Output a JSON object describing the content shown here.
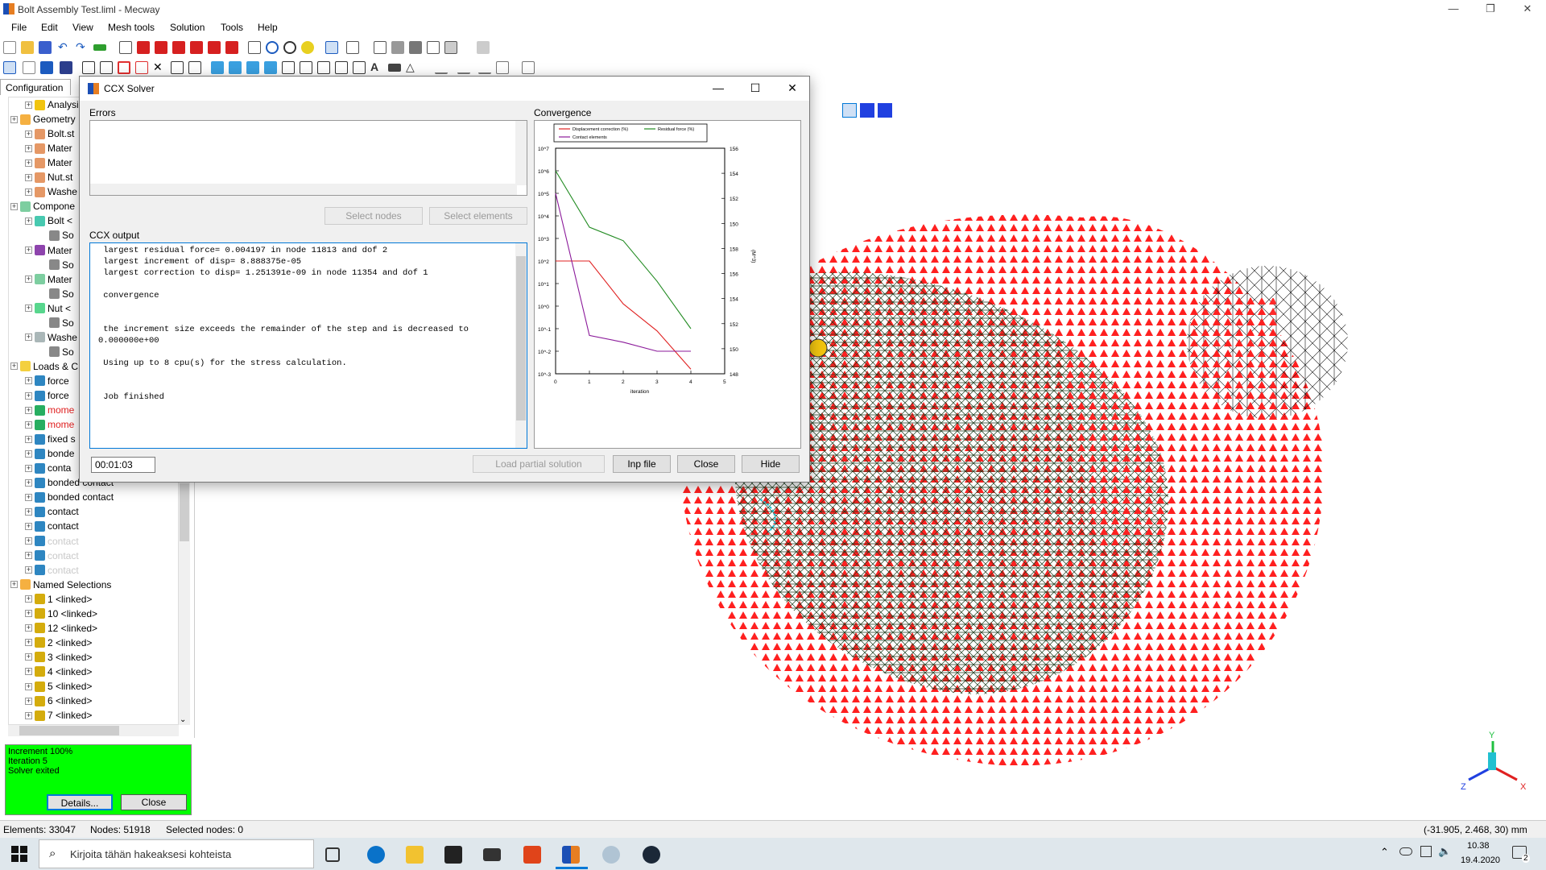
{
  "window": {
    "title": "Bolt Assembly Test.liml - Mecway",
    "minimize": "—",
    "restore": "❐",
    "close": "✕"
  },
  "menu": [
    "File",
    "Edit",
    "View",
    "Mesh tools",
    "Solution",
    "Tools",
    "Help"
  ],
  "left_panel": {
    "tab": "Configuration",
    "tree": [
      {
        "label": "Analysis <",
        "depth": 1,
        "color": "#f1c40f"
      },
      {
        "label": "Geometry",
        "depth": 0,
        "color": "#f5b041"
      },
      {
        "label": "Bolt.st",
        "depth": 1,
        "color": "#e59866"
      },
      {
        "label": "Mater",
        "depth": 1,
        "color": "#e59866"
      },
      {
        "label": "Mater",
        "depth": 1,
        "color": "#e59866"
      },
      {
        "label": "Nut.st",
        "depth": 1,
        "color": "#e59866"
      },
      {
        "label": "Washe",
        "depth": 1,
        "color": "#e59866"
      },
      {
        "label": "Compone",
        "depth": 0,
        "color": "#7dcea0"
      },
      {
        "label": "Bolt <",
        "depth": 1,
        "color": "#48c9b0"
      },
      {
        "label": "So",
        "depth": 2,
        "color": "#888888"
      },
      {
        "label": "Mater",
        "depth": 1,
        "color": "#8e44ad"
      },
      {
        "label": "So",
        "depth": 2,
        "color": "#888888"
      },
      {
        "label": "Mater",
        "depth": 1,
        "color": "#7dcea0"
      },
      {
        "label": "So",
        "depth": 2,
        "color": "#888888"
      },
      {
        "label": "Nut <",
        "depth": 1,
        "color": "#58d68d"
      },
      {
        "label": "So",
        "depth": 2,
        "color": "#888888"
      },
      {
        "label": "Washe",
        "depth": 1,
        "color": "#aab7b8"
      },
      {
        "label": "So",
        "depth": 2,
        "color": "#888888"
      },
      {
        "label": "Loads & C",
        "depth": 0,
        "color": "#f4d03f"
      },
      {
        "label": "force",
        "depth": 1,
        "color": "#2e86c1"
      },
      {
        "label": "force",
        "depth": 1,
        "color": "#2e86c1"
      },
      {
        "label": "mome",
        "depth": 1,
        "color": "#27ae60",
        "text_color": "#e02020"
      },
      {
        "label": "mome",
        "depth": 1,
        "color": "#27ae60",
        "text_color": "#e02020"
      },
      {
        "label": "fixed s",
        "depth": 1,
        "color": "#2e86c1"
      },
      {
        "label": "bonde",
        "depth": 1,
        "color": "#2e86c1"
      },
      {
        "label": "conta",
        "depth": 1,
        "color": "#2e86c1"
      },
      {
        "label": "bonded contact",
        "depth": 1,
        "color": "#2e86c1"
      },
      {
        "label": "bonded contact",
        "depth": 1,
        "color": "#2e86c1"
      },
      {
        "label": "contact",
        "depth": 1,
        "color": "#2e86c1"
      },
      {
        "label": "contact",
        "depth": 1,
        "color": "#2e86c1"
      },
      {
        "label": "contact",
        "depth": 1,
        "color": "#2e86c1",
        "text_color": "#c8c8c8"
      },
      {
        "label": "contact",
        "depth": 1,
        "color": "#2e86c1",
        "text_color": "#c8c8c8"
      },
      {
        "label": "contact",
        "depth": 1,
        "color": "#2e86c1",
        "text_color": "#c8c8c8"
      },
      {
        "label": "Named Selections",
        "depth": 0,
        "color": "#f5b041"
      },
      {
        "label": "1 <linked>",
        "depth": 1,
        "color": "#d4ac0d"
      },
      {
        "label": "10 <linked>",
        "depth": 1,
        "color": "#d4ac0d"
      },
      {
        "label": "12 <linked>",
        "depth": 1,
        "color": "#d4ac0d"
      },
      {
        "label": "2 <linked>",
        "depth": 1,
        "color": "#d4ac0d"
      },
      {
        "label": "3 <linked>",
        "depth": 1,
        "color": "#d4ac0d"
      },
      {
        "label": "4 <linked>",
        "depth": 1,
        "color": "#d4ac0d"
      },
      {
        "label": "5 <linked>",
        "depth": 1,
        "color": "#d4ac0d"
      },
      {
        "label": "6 <linked>",
        "depth": 1,
        "color": "#d4ac0d"
      },
      {
        "label": "7 <linked>",
        "depth": 1,
        "color": "#d4ac0d"
      }
    ],
    "status": {
      "line1": "Increment 100%",
      "line2": "Iteration 5",
      "line3": "Solver exited",
      "details_btn": "Details...",
      "close_btn": "Close"
    }
  },
  "dialog": {
    "title": "CCX Solver",
    "errors_label": "Errors",
    "select_nodes": "Select nodes",
    "select_elements": "Select elements",
    "output_label": "CCX output",
    "output_text": " largest residual force= 0.004197 in node 11813 and dof 2\n largest increment of disp= 8.888375e-05\n largest correction to disp= 1.251391e-09 in node 11354 and dof 1\n\n convergence\n\n\n the increment size exceeds the remainder of the step and is decreased to\n0.000000e+00\n\n Using up to 8 cpu(s) for the stress calculation.\n\n\n Job finished\n\n\n",
    "convergence_label": "Convergence",
    "timer": "00:01:03",
    "load_partial": "Load partial solution",
    "inp_file": "Inp file",
    "close": "Close",
    "hide": "Hide"
  },
  "chart_data": {
    "type": "line",
    "title": "",
    "xlabel": "iteration",
    "ylabel_right": "(M^3)",
    "x": [
      0,
      1,
      2,
      3,
      4
    ],
    "xlim": [
      0,
      5
    ],
    "ylim_log": [
      -3,
      7
    ],
    "y2lim": [
      148,
      156
    ],
    "yticks": [
      "10^7",
      "10^6",
      "10^5",
      "10^4",
      "10^3",
      "10^2",
      "10^1",
      "10^0",
      "10^-1",
      "10^-2",
      "10^-3"
    ],
    "y2ticks": [
      "156",
      "154",
      "152",
      "150",
      "158",
      "156",
      "154",
      "152",
      "150",
      "148"
    ],
    "xticks": [
      "0",
      "1",
      "2",
      "3",
      "4",
      "5"
    ],
    "legend": [
      "Displacement correction (%)",
      "Residual force (%)",
      "Contact elements"
    ],
    "series": [
      {
        "name": "Displacement correction (%)",
        "color": "#e02020",
        "log10_values": [
          2,
          2,
          0.1,
          -1.1,
          -2.8
        ]
      },
      {
        "name": "Residual force (%)",
        "color": "#228b22",
        "log10_values": [
          6,
          3.5,
          2.9,
          1.1,
          -1
        ]
      },
      {
        "name": "Contact elements",
        "color": "#8b1a9a",
        "log10_values": [
          5,
          -1.3,
          -1.6,
          -2,
          -2
        ]
      }
    ]
  },
  "statusbar": {
    "elements": "Elements: 33047",
    "nodes": "Nodes: 51918",
    "selected": "Selected nodes: 0",
    "coords": "(-31.905, 2.468, 30) mm"
  },
  "taskbar": {
    "search_placeholder": "Kirjoita tähän hakeaksesi kohteista",
    "time": "10.38",
    "date": "19.4.2020",
    "notif_count": "2"
  }
}
